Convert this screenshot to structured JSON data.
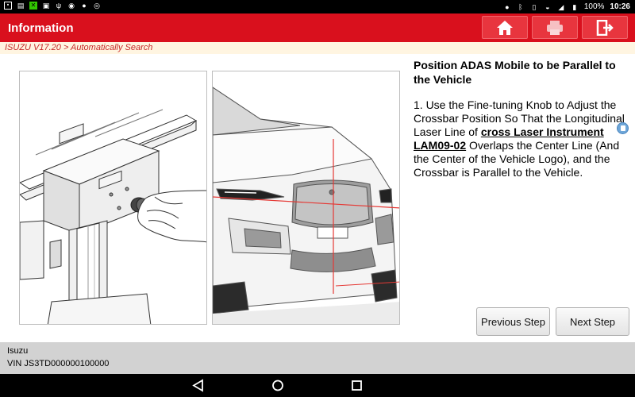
{
  "status_bar": {
    "battery": "100%",
    "clock": "10:26"
  },
  "header": {
    "title": "Information"
  },
  "breadcrumb": "ISUZU V17.20 > Automatically Search",
  "step": {
    "title": "Position ADAS Mobile to be Parallel to the Vehicle",
    "body_before": "1. Use the Fine-tuning Knob to Adjust the Crossbar Position So That the Longitudinal Laser Line of ",
    "link_text": "cross Laser Instrument LAM09-02",
    "body_after": " Overlaps the Center Line (And the Center of the Vehicle Logo), and the Crossbar is Parallel to the Vehicle."
  },
  "buttons": {
    "previous": "Previous Step",
    "next": "Next Step"
  },
  "footer": {
    "make": "Isuzu",
    "vin": "VIN JS3TD000000100000"
  },
  "icons": {
    "home": "home-icon",
    "print": "print-icon",
    "exit": "exit-icon",
    "note": "note-icon",
    "back": "back-icon",
    "nav_home": "circle-home-icon",
    "recents": "recents-icon"
  },
  "colors": {
    "header": "#d9101d",
    "breadcrumb_bg": "#fff5e1",
    "breadcrumb_text": "#c62828",
    "footer": "#d2d2d2",
    "laser": "#e53935"
  }
}
